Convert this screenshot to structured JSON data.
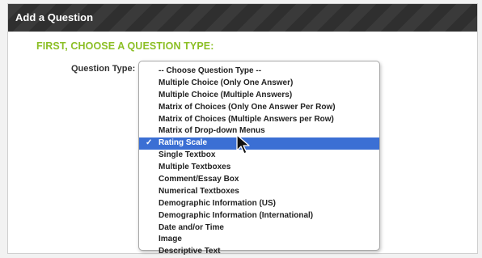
{
  "header": {
    "title": "Add a Question"
  },
  "section": {
    "title": "FIRST, CHOOSE A QUESTION TYPE:"
  },
  "field": {
    "label": "Question Type:"
  },
  "dropdown": {
    "selected_index": 6,
    "check_glyph": "✓",
    "options": [
      "-- Choose Question Type --",
      "Multiple Choice (Only One Answer)",
      "Multiple Choice (Multiple Answers)",
      "Matrix of Choices (Only One Answer Per Row)",
      "Matrix of Choices (Multiple Answers per Row)",
      "Matrix of Drop-down Menus",
      "Rating Scale",
      "Single Textbox",
      "Multiple Textboxes",
      "Comment/Essay Box",
      "Numerical Textboxes",
      "Demographic Information (US)",
      "Demographic Information (International)",
      "Date and/or Time",
      "Image",
      "Descriptive Text"
    ]
  },
  "colors": {
    "section_title": "#8cbf26",
    "selection": "#3b6fd4",
    "header_bg": "#333333"
  },
  "icons": {
    "cursor": "mouse-pointer-icon"
  }
}
